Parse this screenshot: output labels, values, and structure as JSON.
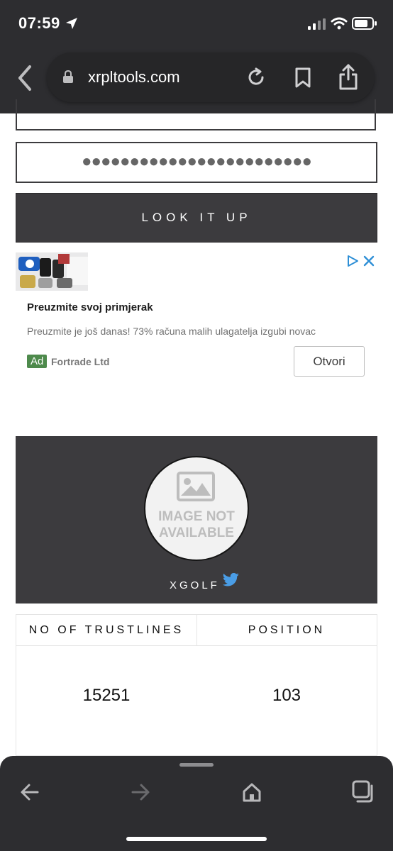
{
  "status_bar": {
    "time": "07:59",
    "location_icon": "location-arrow-icon",
    "signal_icon": "cellular-signal-icon",
    "wifi_icon": "wifi-icon",
    "battery_icon": "battery-icon"
  },
  "browser": {
    "url": "xrpltools.com",
    "back_icon": "chevron-left-icon",
    "lock_icon": "lock-icon",
    "reload_icon": "reload-icon",
    "bookmark_icon": "bookmark-icon",
    "share_icon": "share-icon"
  },
  "form": {
    "password_mask": "●●●●●●●●●●●●●●●●●●●●●●●●",
    "lookup_label": "LOOK IT UP"
  },
  "ad": {
    "title": "Preuzmite svoj primjerak",
    "description": "Preuzmite je još danas! 73% računa malih ulagatelja izgubi novac",
    "badge": "Ad",
    "advertiser": "Fortrade Ltd",
    "cta": "Otvori",
    "choices_icon": "adchoices-icon",
    "close_icon": "close-icon",
    "badge_color": "#4e8a4c"
  },
  "token": {
    "image_text": "IMAGE NOT AVAILABLE",
    "name": "XGOLF",
    "twitter_icon": "twitter-icon",
    "twitter_color": "#4a9de6"
  },
  "stats": {
    "headers": [
      "NO OF TRUSTLINES",
      "POSITION"
    ],
    "values": [
      "15251",
      "103"
    ]
  },
  "toolbar": {
    "back_icon": "arrow-left-icon",
    "forward_icon": "arrow-right-icon",
    "home_icon": "home-icon",
    "tabs_icon": "tabs-icon"
  },
  "colors": {
    "chrome_bg": "#2d2d30",
    "dark_button": "#3c3b3e"
  }
}
